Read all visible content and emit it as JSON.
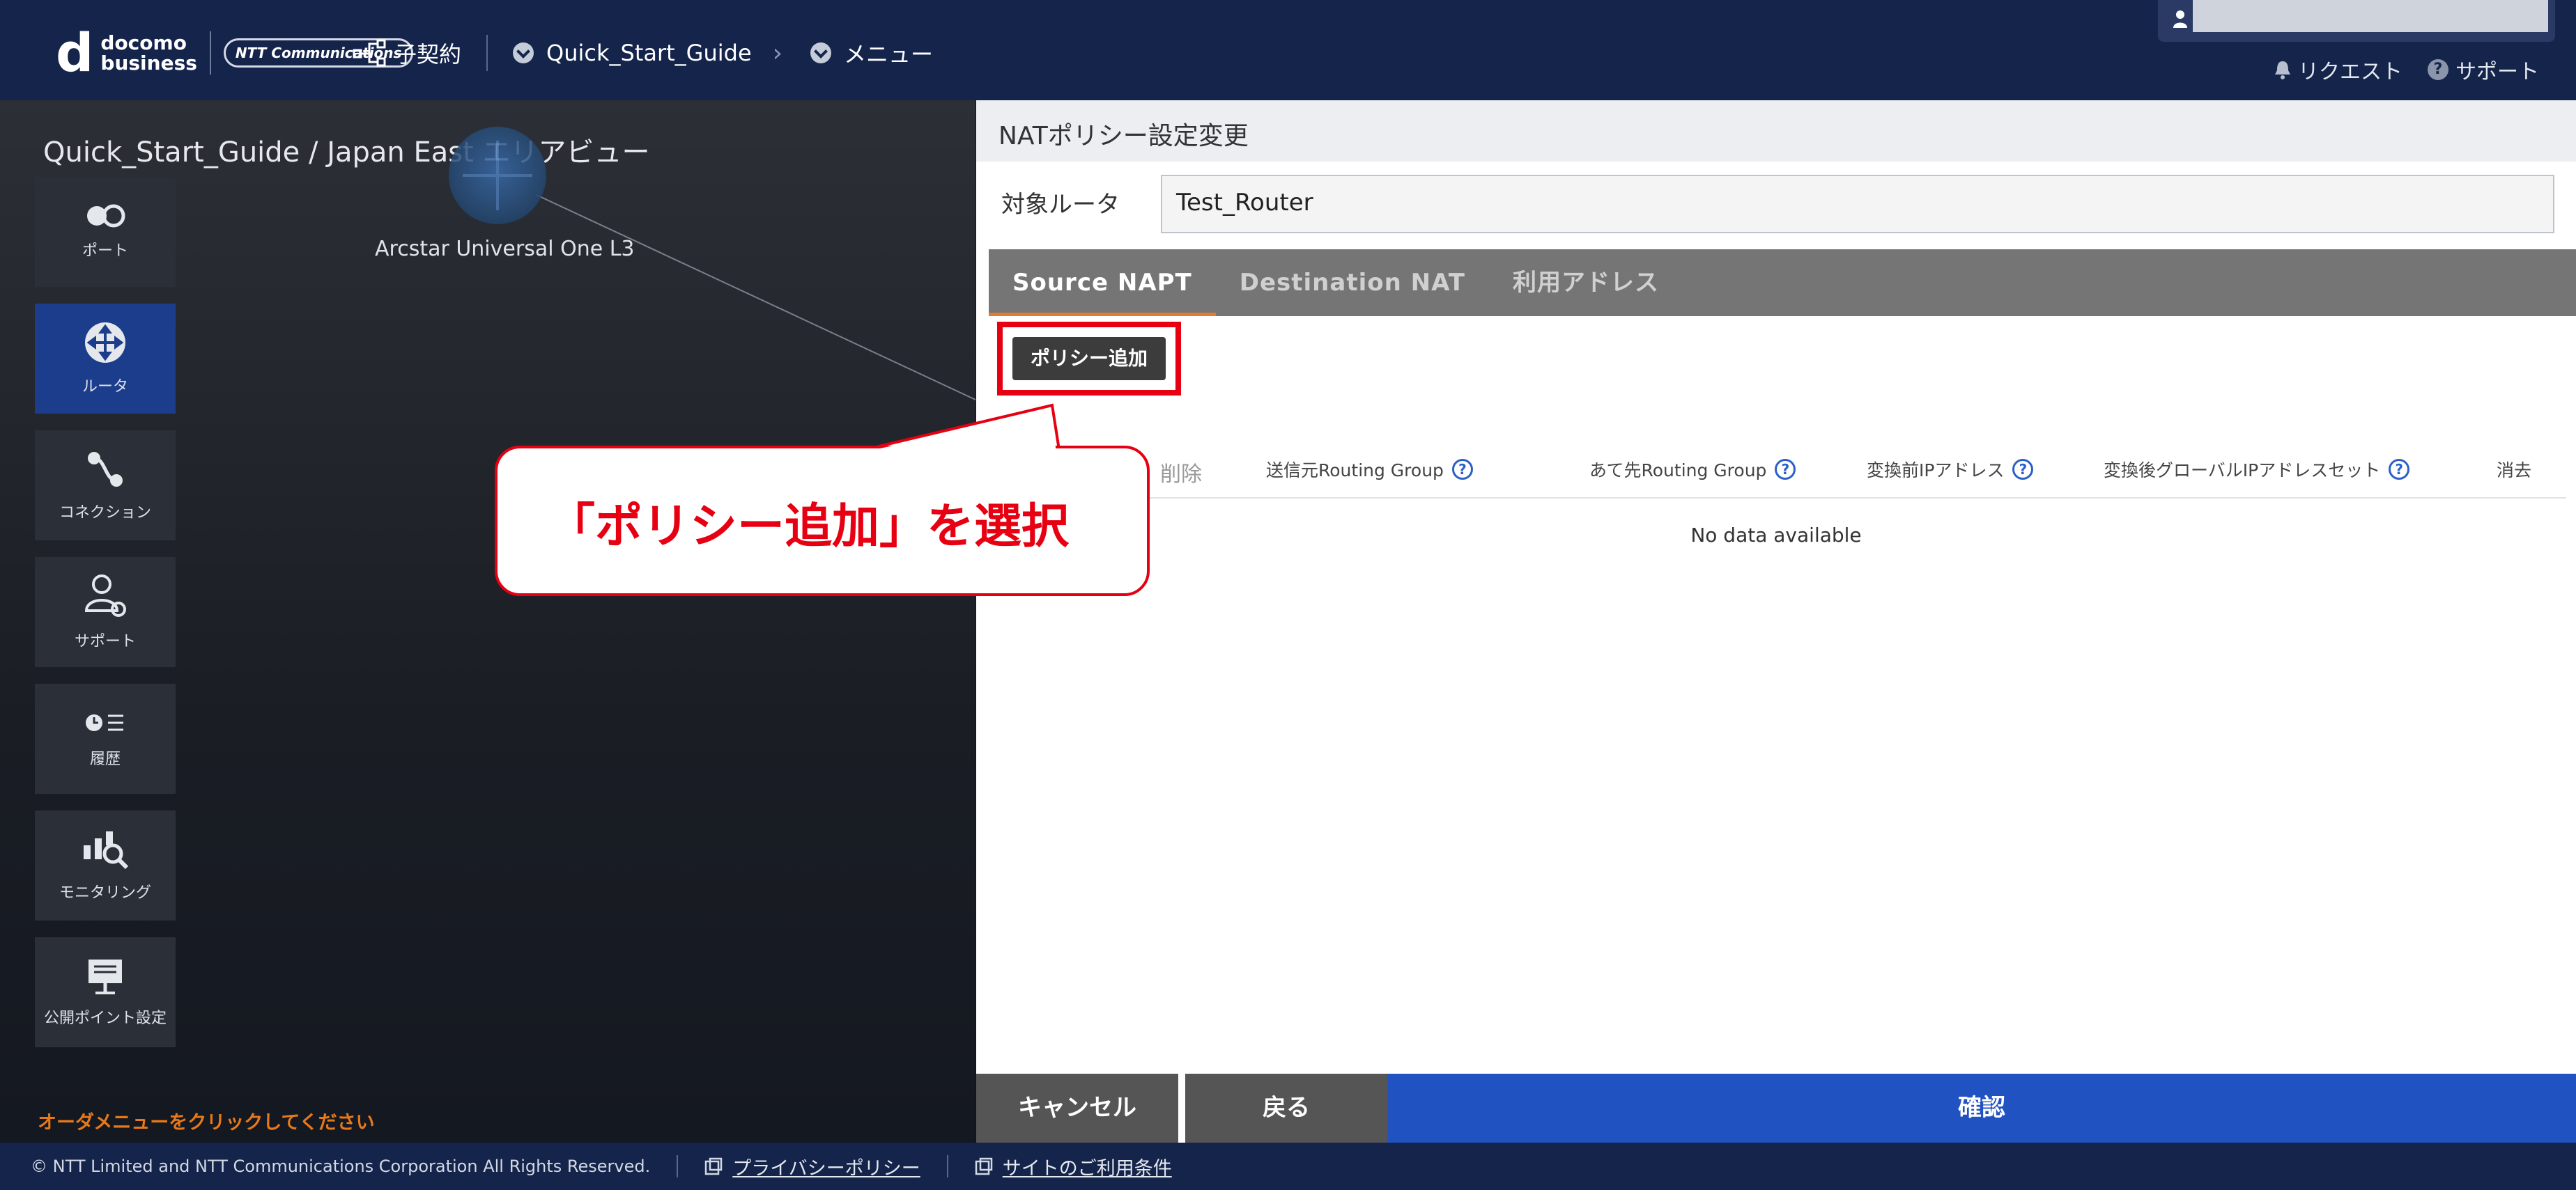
{
  "header": {
    "logo_word1": "docomo",
    "logo_word2": "business",
    "ntt_badge": "NTT Communications",
    "contract_label": "子契約",
    "breadcrumb_project": "Quick_Start_Guide",
    "breadcrumb_menu": "メニュー",
    "request_label": "リクエスト",
    "support_label": "サポート"
  },
  "left": {
    "area_title": "Quick_Start_Guide / Japan East エリアビュー",
    "node_label": "Arcstar Universal One L3",
    "order_hint": "オーダメニューをクリックしてください",
    "sidebar": [
      {
        "label": "ポート",
        "icon": "port-icon"
      },
      {
        "label": "ルータ",
        "icon": "router-icon"
      },
      {
        "label": "コネクション",
        "icon": "connection-icon"
      },
      {
        "label": "サポート",
        "icon": "support-user-icon"
      },
      {
        "label": "履歴",
        "icon": "history-icon"
      },
      {
        "label": "モニタリング",
        "icon": "monitoring-icon"
      },
      {
        "label": "公開ポイント設定",
        "icon": "public-point-icon"
      }
    ]
  },
  "right": {
    "title": "NATポリシー設定変更",
    "target_label": "対象ルータ",
    "target_value": "Test_Router",
    "tabs": [
      "Source NAPT",
      "Destination NAT",
      "利用アドレス"
    ],
    "add_button": "ポリシー追加",
    "columns": {
      "delete": "削除",
      "src_group": "送信元Routing Group",
      "dst_group": "あて先Routing Group",
      "pre_ip": "変換前IPアドレス",
      "post_ip_set": "変換後グローバルIPアドレスセット",
      "erase": "消去"
    },
    "no_data": "No data available",
    "buttons": {
      "cancel": "キャンセル",
      "back": "戻る",
      "confirm": "確認"
    }
  },
  "callout": {
    "text": "「ポリシー追加」を選択"
  },
  "footer": {
    "copyright": "© NTT Limited and NTT Communications Corporation All Rights Reserved.",
    "privacy": "プライバシーポリシー",
    "terms": "サイトのご利用条件"
  },
  "colors": {
    "header_bg": "#14244a",
    "accent_blue": "#2152c2",
    "highlight_red": "#e60012",
    "tab_underline": "#e57a2e",
    "hint_orange": "#e8791a"
  }
}
